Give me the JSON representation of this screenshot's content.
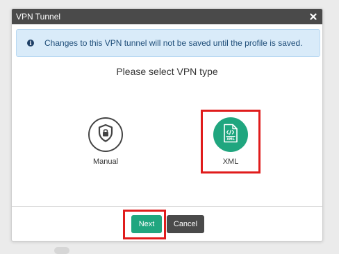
{
  "dialog": {
    "title": "VPN Tunnel",
    "close_icon": "close-icon"
  },
  "info_banner": {
    "icon": "info-icon",
    "text": "Changes to this VPN tunnel will not be saved until the profile is saved."
  },
  "heading": "Please select VPN type",
  "options": [
    {
      "label": "Manual",
      "icon": "shield-lock-icon",
      "selected": false
    },
    {
      "label": "XML",
      "icon": "xml-file-icon",
      "selected": true
    }
  ],
  "footer": {
    "next_label": "Next",
    "cancel_label": "Cancel"
  },
  "colors": {
    "accent": "#20a67f",
    "titlebar": "#4a4a4a",
    "info_bg": "#d9ebf9",
    "info_text": "#1f4e79",
    "highlight": "#e01c1c"
  }
}
